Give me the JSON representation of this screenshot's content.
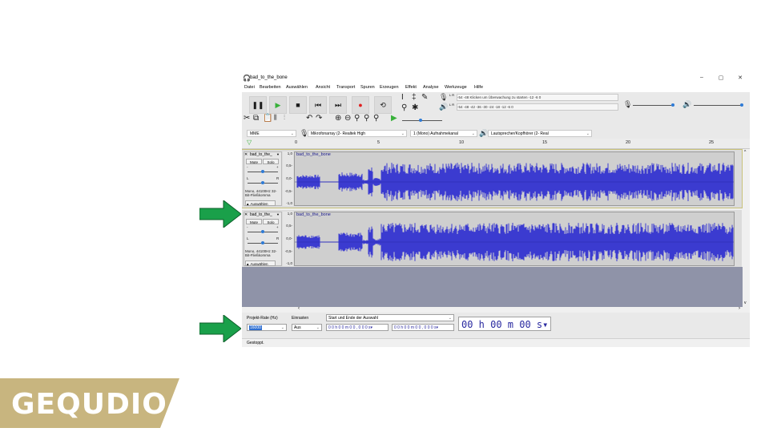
{
  "window": {
    "title": "bad_to_the_bone",
    "controls": {
      "minimize": "–",
      "maximize": "▢",
      "close": "✕"
    }
  },
  "menu": [
    "Datei",
    "Bearbeiten",
    "Auswählen",
    "Ansicht",
    "Transport",
    "Spuren",
    "Erzeugen",
    "Effekt",
    "Analyse",
    "Werkzeuge",
    "Hilfe"
  ],
  "transport": {
    "pause": "❚❚",
    "play": "▶",
    "stop": "■",
    "skip_start": "⏮",
    "skip_end": "⏭",
    "record": "●",
    "loop": "⟲"
  },
  "meters": {
    "record_meter": "-54    -48    Klicken um Überwachung zu starten    -12    -6    0",
    "play_meter": "-54    -48    -42    -36    -30    -24    -18    -12    -6    0",
    "record_meter_channels": "L R",
    "play_meter_channels": "L R"
  },
  "devices": {
    "host": "MME",
    "mic": "Mikrofonarray (2- Realtek High",
    "channels": "1 (Mono) Aufnahmekanal",
    "speaker": "Lautsprecher/Kopfhörer (2- Real"
  },
  "ruler": {
    "ticks": [
      "0",
      "5",
      "10",
      "15",
      "20",
      "25"
    ]
  },
  "tracks": [
    {
      "name": "bad_to_the_",
      "clip_name": "bad_to_the_bone",
      "mute": "Mute",
      "solo": "Solo",
      "gain_minus": "-",
      "gain_plus": "+",
      "pan_left": "L",
      "pan_right": "R",
      "info": "Mono, 44100Hz 32-Bit-Fließkomma",
      "select": "Auswählen",
      "scale": [
        "1,0",
        "0,5-",
        "0,0-",
        "-0,5-",
        "-1,0"
      ]
    },
    {
      "name": "bad_to_the_",
      "clip_name": "bad_to_the_bone",
      "mute": "Mute",
      "solo": "Solo",
      "gain_minus": "-",
      "gain_plus": "+",
      "pan_left": "L",
      "pan_right": "R",
      "info": "Mono, 44100Hz 32-Bit-Fließkomma",
      "select": "Auswählen",
      "scale": [
        "1,0",
        "0,5-",
        "0,0-",
        "-0,5-",
        "-1,0"
      ]
    }
  ],
  "selection": {
    "project_rate_label": "Projekt-Rate (Hz)",
    "project_rate_value": "16000",
    "snap_label": "Einrasten",
    "snap_value": "Aus",
    "range_label": "Start und Ende der Auswahl",
    "start_time": "0 0 h 0 0 m 0 0 , 0 0 0 s▾",
    "end_time": "0 0 h 0 0 m 0 0 , 0 0 0 s▾",
    "big_time": "00 h 00 m 00 s▾"
  },
  "status": "Gestoppt.",
  "logo": {
    "text": "GEQUDIO"
  },
  "colors": {
    "waveform": "#3b3bd0",
    "arrow": "#1aa04a",
    "logo_bg": "#c8b57f",
    "track_bg_empty": "#8f93a8"
  }
}
